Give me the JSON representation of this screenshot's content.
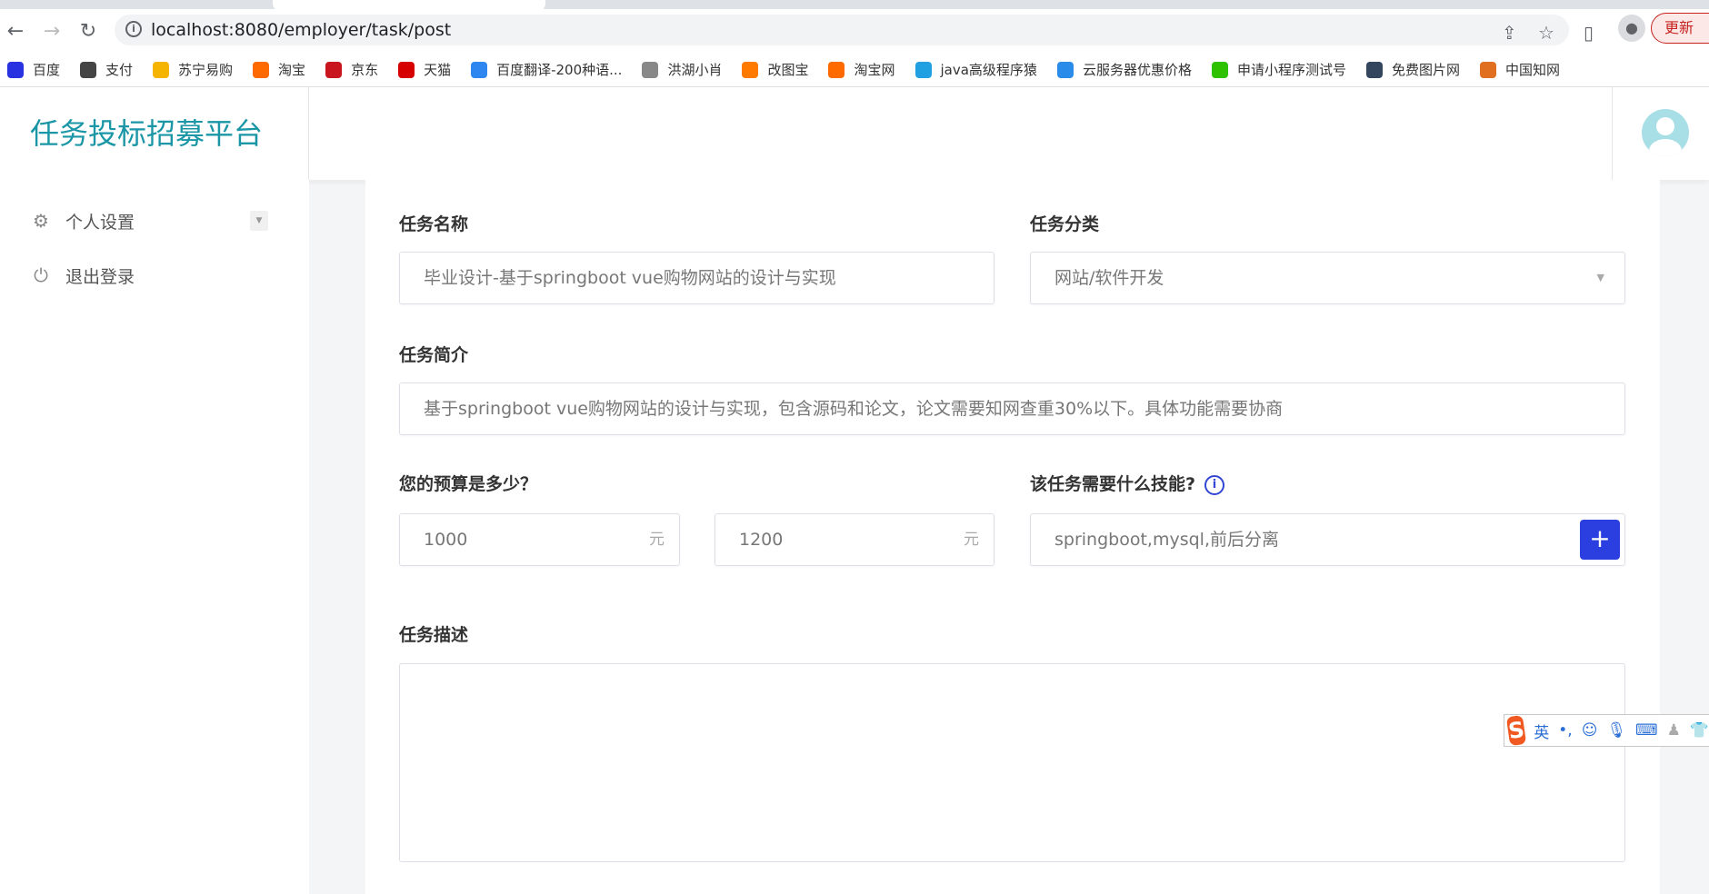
{
  "browser": {
    "url": "localhost:8080/employer/task/post",
    "update_label": "更新",
    "bookmarks": [
      {
        "label": "百度",
        "color": "#2932e1",
        "icon": "baidu-paw"
      },
      {
        "label": "支付",
        "color": "#444444",
        "icon": "globe"
      },
      {
        "label": "苏宁易购",
        "color": "#f5b400",
        "icon": "suning-lion"
      },
      {
        "label": "淘宝",
        "color": "#ff6a00",
        "icon": "taobao"
      },
      {
        "label": "京东",
        "color": "#c9151e",
        "icon": "jd"
      },
      {
        "label": "天猫",
        "color": "#d60000",
        "icon": "tmall"
      },
      {
        "label": "百度翻译-200种语...",
        "color": "#2e86f0",
        "icon": "translate"
      },
      {
        "label": "洪湖小肖",
        "color": "#888888",
        "icon": "bird"
      },
      {
        "label": "改图宝",
        "color": "#ff7a00",
        "icon": "gaitubao"
      },
      {
        "label": "淘宝网",
        "color": "#ff6a00",
        "icon": "taobao"
      },
      {
        "label": "java高级程序猿",
        "color": "#20a0e0",
        "icon": "bilibili"
      },
      {
        "label": "云服务器优惠价格",
        "color": "#2a8be8",
        "icon": "cloud"
      },
      {
        "label": "申请小程序测试号",
        "color": "#2dc100",
        "icon": "wechat"
      },
      {
        "label": "免费图片网",
        "color": "#34465d",
        "icon": "tumblr"
      },
      {
        "label": "中国知网",
        "color": "#e07020",
        "icon": "cnki"
      }
    ]
  },
  "app": {
    "title": "任务投标招募平台",
    "sidebar": [
      {
        "label": "个人设置",
        "icon": "gear-icon"
      },
      {
        "label": "退出登录",
        "icon": "power-icon"
      }
    ]
  },
  "form": {
    "name_label": "任务名称",
    "name_value": "毕业设计-基于springboot vue购物网站的设计与实现",
    "category_label": "任务分类",
    "category_value": "网站/软件开发",
    "intro_label": "任务简介",
    "intro_value": "基于springboot vue购物网站的设计与实现，包含源码和论文，论文需要知网查重30%以下。具体功能需要协商",
    "budget_label": "您的预算是多少？",
    "budget_min": "1000",
    "budget_max": "1200",
    "unit": "元",
    "skills_label": "该任务需要什么技能?",
    "skills_value": "springboot,mysql,前后分离",
    "add_label": "+",
    "desc_label": "任务描述",
    "desc_value": ""
  },
  "ime": {
    "mode": "英"
  },
  "colors": {
    "brand": "#1a96a6",
    "primary": "#2b3fe0"
  }
}
